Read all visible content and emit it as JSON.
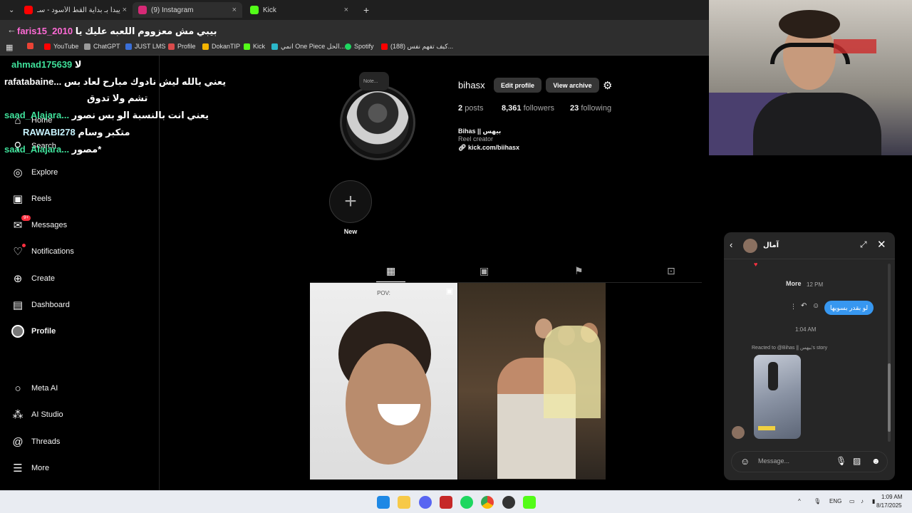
{
  "browser": {
    "tabs": [
      {
        "label": "هيبته يبدأ بـ بداية القط الأسود - سـ"
      },
      {
        "label": "(9) Instagram"
      },
      {
        "label": "Kick"
      }
    ],
    "bookmarks": [
      {
        "label": "YouTube",
        "color": "#ff0000"
      },
      {
        "label": "ChatGPT",
        "color": "#999999"
      },
      {
        "label": "JUST LMS",
        "color": "#3a6fd8"
      },
      {
        "label": "Profile",
        "color": "#d94b4b"
      },
      {
        "label": "DokanTIP",
        "color": "#f4b400"
      },
      {
        "label": "Kick",
        "color": "#53fc18"
      },
      {
        "label": "انمي One Piece الحل...",
        "color": "#2bb7c9"
      },
      {
        "label": "Spotify",
        "color": "#1ed760"
      },
      {
        "label": "(188) كيف تفهم نفس...",
        "color": "#ff0000"
      }
    ]
  },
  "sidebar": {
    "items": [
      {
        "label": "Home",
        "icon": "home-icon"
      },
      {
        "label": "Search",
        "icon": "search-icon"
      },
      {
        "label": "Explore",
        "icon": "compass-icon"
      },
      {
        "label": "Reels",
        "icon": "reels-icon"
      },
      {
        "label": "Messages",
        "icon": "messenger-icon",
        "badge": "9+"
      },
      {
        "label": "Notifications",
        "icon": "heart-icon"
      },
      {
        "label": "Create",
        "icon": "plus-square-icon"
      },
      {
        "label": "Dashboard",
        "icon": "dashboard-icon"
      },
      {
        "label": "Profile",
        "icon": "avatar-icon"
      },
      {
        "label": "Meta AI",
        "icon": "meta-ai-icon"
      },
      {
        "label": "AI Studio",
        "icon": "ai-studio-icon"
      },
      {
        "label": "Threads",
        "icon": "threads-icon"
      },
      {
        "label": "More",
        "icon": "menu-icon"
      }
    ]
  },
  "stream_chat": [
    {
      "user": "faris15_2010",
      "message": "بيبي مش معزووم اللعبه عليك يا"
    },
    {
      "user": "ahmad175639",
      "message": "لا"
    },
    {
      "user": "rafatabaine...",
      "message": "يعني بالله ليش نادوك مبارح لعاد بس"
    },
    {
      "user": "",
      "message": "تشم ولا تدوق"
    },
    {
      "user": "saad_Alajara...",
      "message": "يعني انت بالنسبة الو بس نصور"
    },
    {
      "user": "RAWABI278",
      "message": "متكبر وسام"
    },
    {
      "user": "saad_Alajara...",
      "message": "مصور*"
    }
  ],
  "profile": {
    "note": "Note...",
    "username": "bihasx",
    "edit_label": "Edit profile",
    "archive_label": "View archive",
    "posts_count": "2",
    "posts_label": "posts",
    "followers_count": "8,361",
    "followers_label": "followers",
    "following_count": "23",
    "following_label": "following",
    "display_name": "Bihas || بيهس",
    "category": "Reel creator",
    "link": "kick.com/biihasx",
    "new_label": "New",
    "post1_caption": "POV:"
  },
  "dm": {
    "name": "آمال",
    "more_label": "More",
    "time1": "12 PM",
    "bubble_text": "لو بقدر بسويها",
    "time2": "1:04 AM",
    "reaction_text": "Reacted to @Bihas || بيهس's story",
    "placeholder": "Message..."
  },
  "taskbar": {
    "lang": "ENG",
    "time": "1:09 AM",
    "date": "8/17/2025"
  }
}
